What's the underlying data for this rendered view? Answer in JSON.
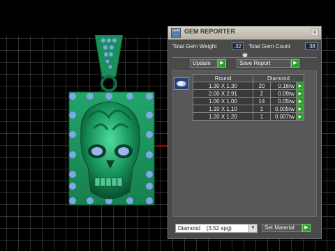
{
  "panel": {
    "title": "GEM REPORTER",
    "title_icon_text": "GEM",
    "close_label": "×",
    "total_weight_label": "Total Gem Weight",
    "total_weight_value": ".32",
    "total_count_label": "Total Gem Count",
    "total_count_value": "38",
    "update_label": "Update",
    "save_report_label": "Save Report",
    "table": {
      "headers": [
        "Round",
        "Diamond"
      ],
      "rows": [
        {
          "size": "1.30 X 1.30",
          "count": "20",
          "tw": "0.16tw"
        },
        {
          "size": "2.00 X 2.91",
          "count": "2",
          "tw": "0.09tw"
        },
        {
          "size": "1.00 X 1.00",
          "count": "14",
          "tw": "0.05tw"
        },
        {
          "size": "1.10 X 1.10",
          "count": "1",
          "tw": "0.005tw"
        },
        {
          "size": "1.20 X 1.20",
          "count": "1",
          "tw": "0.007tw"
        }
      ]
    },
    "material_value": "Diamond    (3.52 spg)",
    "set_material_label": "Set Material"
  },
  "icons": {
    "arrow": "▶",
    "dropdown": "▼",
    "collapse": "⌃"
  },
  "colors": {
    "pendant_green": "#1f9a60",
    "gem_blue": "#7fa6e8",
    "button_green": "#2e9d2e"
  }
}
